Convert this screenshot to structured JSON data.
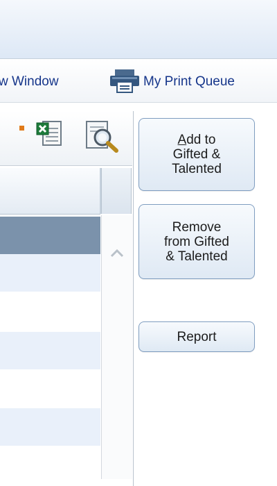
{
  "toolbar": {
    "new_window_label": "w Window",
    "print_queue_label": "My Print Queue"
  },
  "icons": {
    "printer": "printer-icon",
    "excel": "excel-export-icon",
    "preview": "print-preview-icon"
  },
  "actions": {
    "add": {
      "underline_char": "A",
      "line1_rest": "dd to",
      "line2": "Gifted &",
      "line3": "Talented"
    },
    "remove": {
      "line1": "Remove",
      "line2": "from Gifted",
      "line3": "& Talented"
    },
    "report_label": "Report"
  },
  "grid": {
    "rows": [
      {
        "state": "selected"
      },
      {
        "state": "alt"
      },
      {
        "state": "plain"
      },
      {
        "state": "alt"
      },
      {
        "state": "plain"
      },
      {
        "state": "alt"
      },
      {
        "state": "plain"
      }
    ]
  },
  "colors": {
    "selected_row": "#7b92ab",
    "alt_row": "#e9f0fa",
    "link": "#15358a",
    "button_border": "#7f9dc0"
  }
}
